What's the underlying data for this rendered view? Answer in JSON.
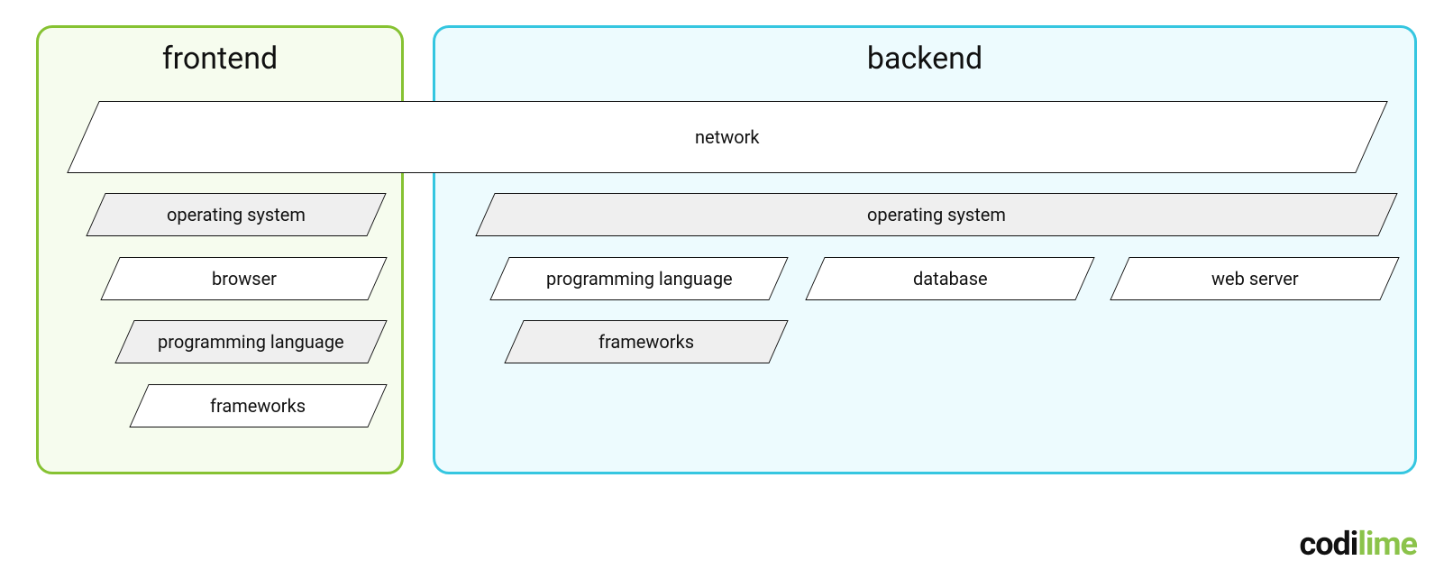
{
  "frontend": {
    "title": "frontend",
    "layers": {
      "os": "operating system",
      "browser": "browser",
      "lang": "programming language",
      "fw": "frameworks"
    }
  },
  "backend": {
    "title": "backend",
    "layers": {
      "os": "operating system",
      "lang": "programming language",
      "db": "database",
      "web": "web server",
      "fw": "frameworks"
    }
  },
  "shared": {
    "network": "network"
  },
  "logo": {
    "codi": "codi",
    "lime": "lime"
  },
  "colors": {
    "frontend_border": "#86c232",
    "frontend_fill": "#f6fcee",
    "backend_border": "#35c6e0",
    "backend_fill": "#edfbfe",
    "grey": "#efefef",
    "white": "#ffffff",
    "text": "#111111"
  }
}
